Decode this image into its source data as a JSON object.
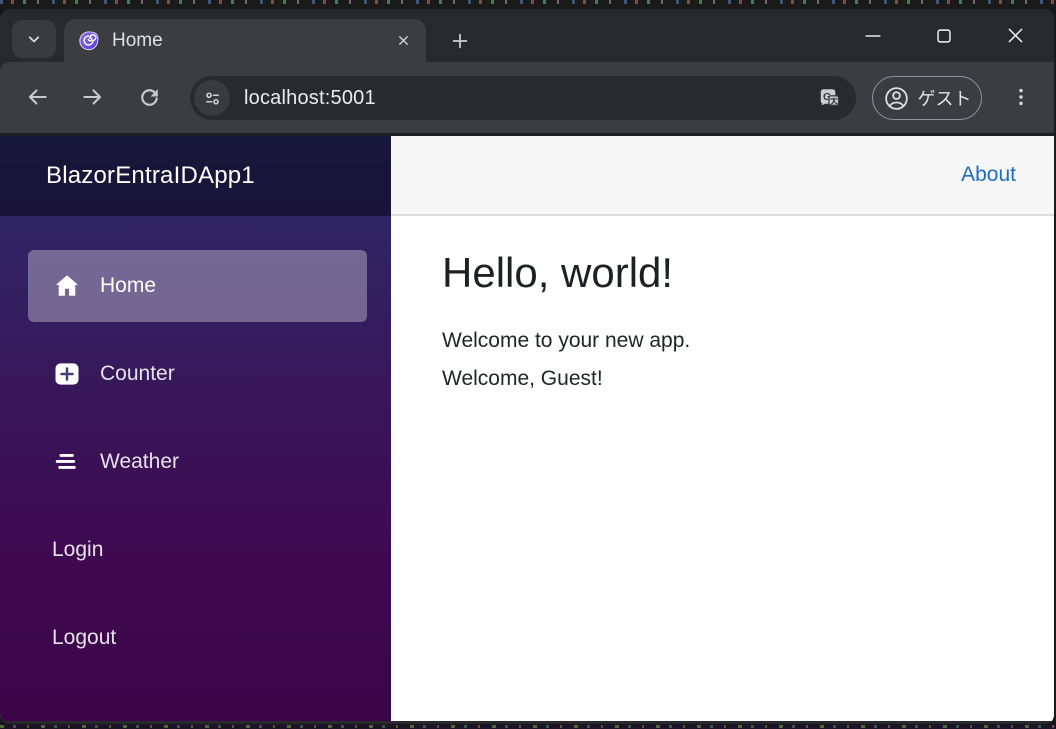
{
  "colors": {
    "link_blue": "#1b6ec2",
    "sidebar_gradient_top": "#2b2c69",
    "sidebar_gradient_bottom": "#3a0647",
    "active_nav_bg": "rgba(255,255,255,0.32)",
    "chrome_frame": "#28292b",
    "chrome_toolbar": "#3c3d40",
    "main_topbar_bg": "#f7f7f7"
  },
  "browser": {
    "tab": {
      "title": "Home",
      "favicon": "blazor-swirl-icon"
    },
    "toolbar": {
      "url": "localhost:5001",
      "profile_label": "ゲスト"
    },
    "icons": {
      "tab_search": "chevron-down-icon",
      "tab_close": "close-icon",
      "new_tab": "plus-icon",
      "minimize": "minimize-icon",
      "maximize": "maximize-icon",
      "window_close": "close-icon",
      "back": "arrow-left-icon",
      "forward": "arrow-right-icon",
      "reload": "reload-icon",
      "site_info": "tune-icon",
      "translate": "translate-icon",
      "profile": "person-circle-icon",
      "menu": "kebab-menu-icon"
    }
  },
  "app": {
    "brand": "BlazorEntraIDApp1",
    "header_link": "About",
    "nav_items": [
      {
        "label": "Home",
        "icon": "house-icon",
        "active": true
      },
      {
        "label": "Counter",
        "icon": "plus-square-icon",
        "active": false
      },
      {
        "label": "Weather",
        "icon": "list-icon",
        "active": false
      },
      {
        "label": "Login",
        "icon": null,
        "active": false
      },
      {
        "label": "Logout",
        "icon": null,
        "active": false
      }
    ],
    "content": {
      "heading": "Hello, world!",
      "welcome_line1": "Welcome to your new app.",
      "welcome_line2": "Welcome, Guest!"
    }
  }
}
